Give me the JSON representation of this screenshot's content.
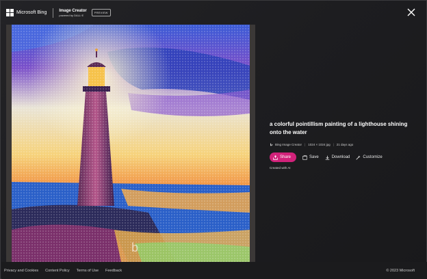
{
  "header": {
    "brand_label": "Microsoft Bing",
    "product_title": "Image Creator",
    "product_subtitle": "powered by DALL·E",
    "badge": "PREVIEW"
  },
  "image": {
    "description_icon": "bing-watermark-icon"
  },
  "details": {
    "title": "a colorful pointillism painting of a lighthouse shining onto the water",
    "source": "Bing Image Creator",
    "dimensions": "1024 × 1024 jpg",
    "age": "21 days ago",
    "actions": {
      "share": "Share",
      "save": "Save",
      "download": "Download",
      "customize": "Customize"
    },
    "created_note": "Created with AI"
  },
  "footer": {
    "links": [
      "Privacy and Cookies",
      "Content Policy",
      "Terms of Use",
      "Feedback"
    ],
    "copyright": "© 2023 Microsoft"
  },
  "colors": {
    "share_accent": "#d1227a",
    "background": "#1d1d20"
  }
}
